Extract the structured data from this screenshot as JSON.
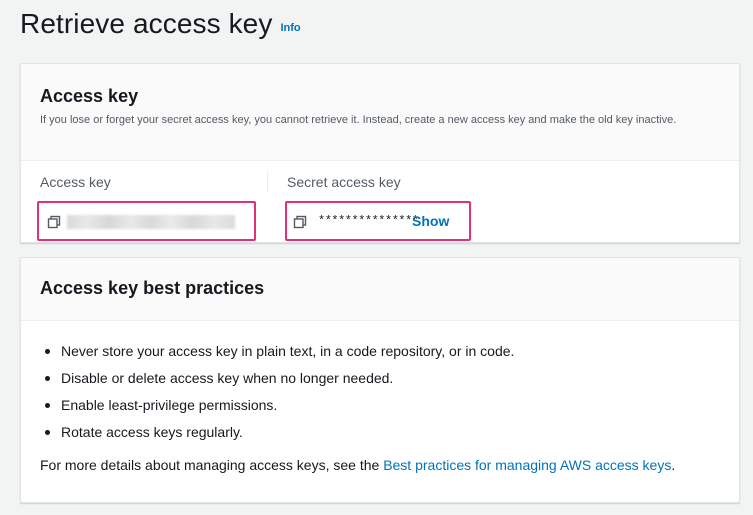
{
  "page": {
    "title": "Retrieve access key",
    "info_label": "Info"
  },
  "access_key_card": {
    "title": "Access key",
    "description": "If you lose or forget your secret access key, you cannot retrieve it. Instead, create a new access key and make the old key inactive.",
    "columns": [
      {
        "label": "Access key"
      },
      {
        "label": "Secret access key"
      }
    ],
    "secret_masked": "***************",
    "show_label": "Show",
    "highlight_color": "#e22f77"
  },
  "best_practices_card": {
    "title": "Access key best practices",
    "items": [
      "Never store your access key in plain text, in a code repository, or in code.",
      "Disable or delete access key when no longer needed.",
      "Enable least-privilege permissions.",
      "Rotate access keys regularly."
    ],
    "more_prefix": "For more details about managing access keys, see the ",
    "more_link": "Best practices for managing AWS access keys",
    "more_suffix": "."
  },
  "icons": {
    "copy": "copy-icon"
  },
  "colors": {
    "link": "#0073bb",
    "background": "#f2f3f3"
  }
}
